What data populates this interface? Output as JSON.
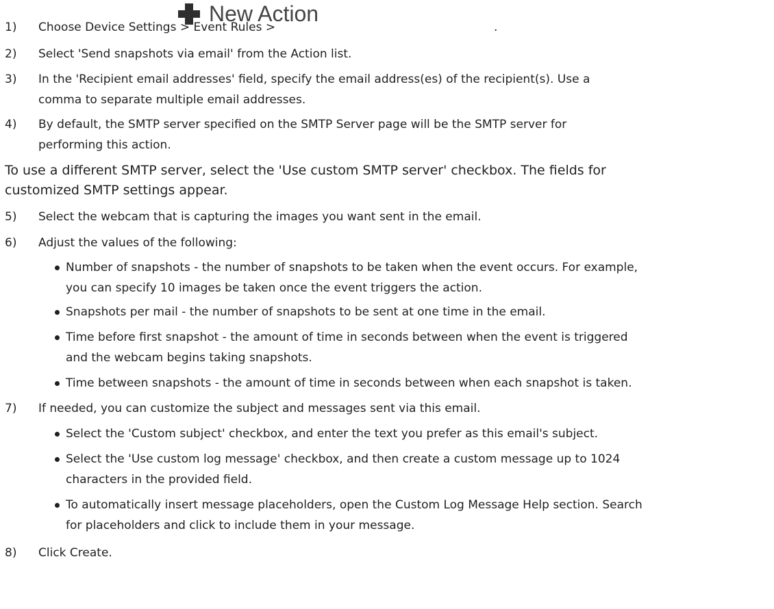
{
  "steps": {
    "s1": {
      "num": "1)",
      "text": "Choose Device Settings > Event Rules >",
      "button_label": "New Action",
      "tail": "."
    },
    "s2": {
      "num": "2)",
      "text": "Select 'Send snapshots via email' from the Action list."
    },
    "s3": {
      "num": "3)",
      "line1": "In the 'Recipient email addresses' field, specify the email address(es) of the recipient(s). Use a",
      "line2": "comma to separate multiple email addresses."
    },
    "s4": {
      "num": "4)",
      "line1": "By default, the SMTP server specified on the SMTP Server page will be the SMTP server for",
      "line2": "performing this action."
    },
    "note": {
      "line1": "To use a different SMTP server, select the 'Use custom SMTP server' checkbox. The fields for",
      "line2": "customized SMTP settings appear."
    },
    "s5": {
      "num": "5)",
      "text": "Select the webcam that is capturing the images you want sent in the email."
    },
    "s6": {
      "num": "6)",
      "text": "Adjust the values of the following:"
    },
    "s7": {
      "num": "7)",
      "text": "If needed, you can customize the subject and messages sent via this email."
    },
    "s8": {
      "num": "8)",
      "text": "Click Create."
    }
  },
  "bullets6": {
    "b1": {
      "line1": "Number of snapshots - the number of snapshots to be taken when the event occurs. For example,",
      "line2": "you can specify 10 images be taken once the event triggers the action."
    },
    "b2": {
      "line1": "Snapshots per mail - the number of snapshots to be sent at one time in the email."
    },
    "b3": {
      "line1": "Time before first snapshot - the amount of time in seconds between when the event is triggered",
      "line2": "and the webcam begins taking snapshots."
    },
    "b4": {
      "line1": "Time between snapshots - the amount of time in seconds between when each snapshot is taken."
    }
  },
  "bullets7": {
    "b1": {
      "line1": "Select the 'Custom subject' checkbox, and enter the text you prefer as this email's subject."
    },
    "b2": {
      "line1": "Select the 'Use custom log message' checkbox, and then create a custom message up to 1024",
      "line2": "characters in the provided field."
    },
    "b3": {
      "line1": "To automatically insert message placeholders, open the Custom Log Message Help section. Search",
      "line2": "for placeholders and click to include them in your message."
    }
  },
  "icons": {
    "plus": "plus-icon"
  },
  "colors": {
    "text": "#1f1f1f",
    "icon": "#2e2e2e",
    "button_text": "#444444"
  }
}
